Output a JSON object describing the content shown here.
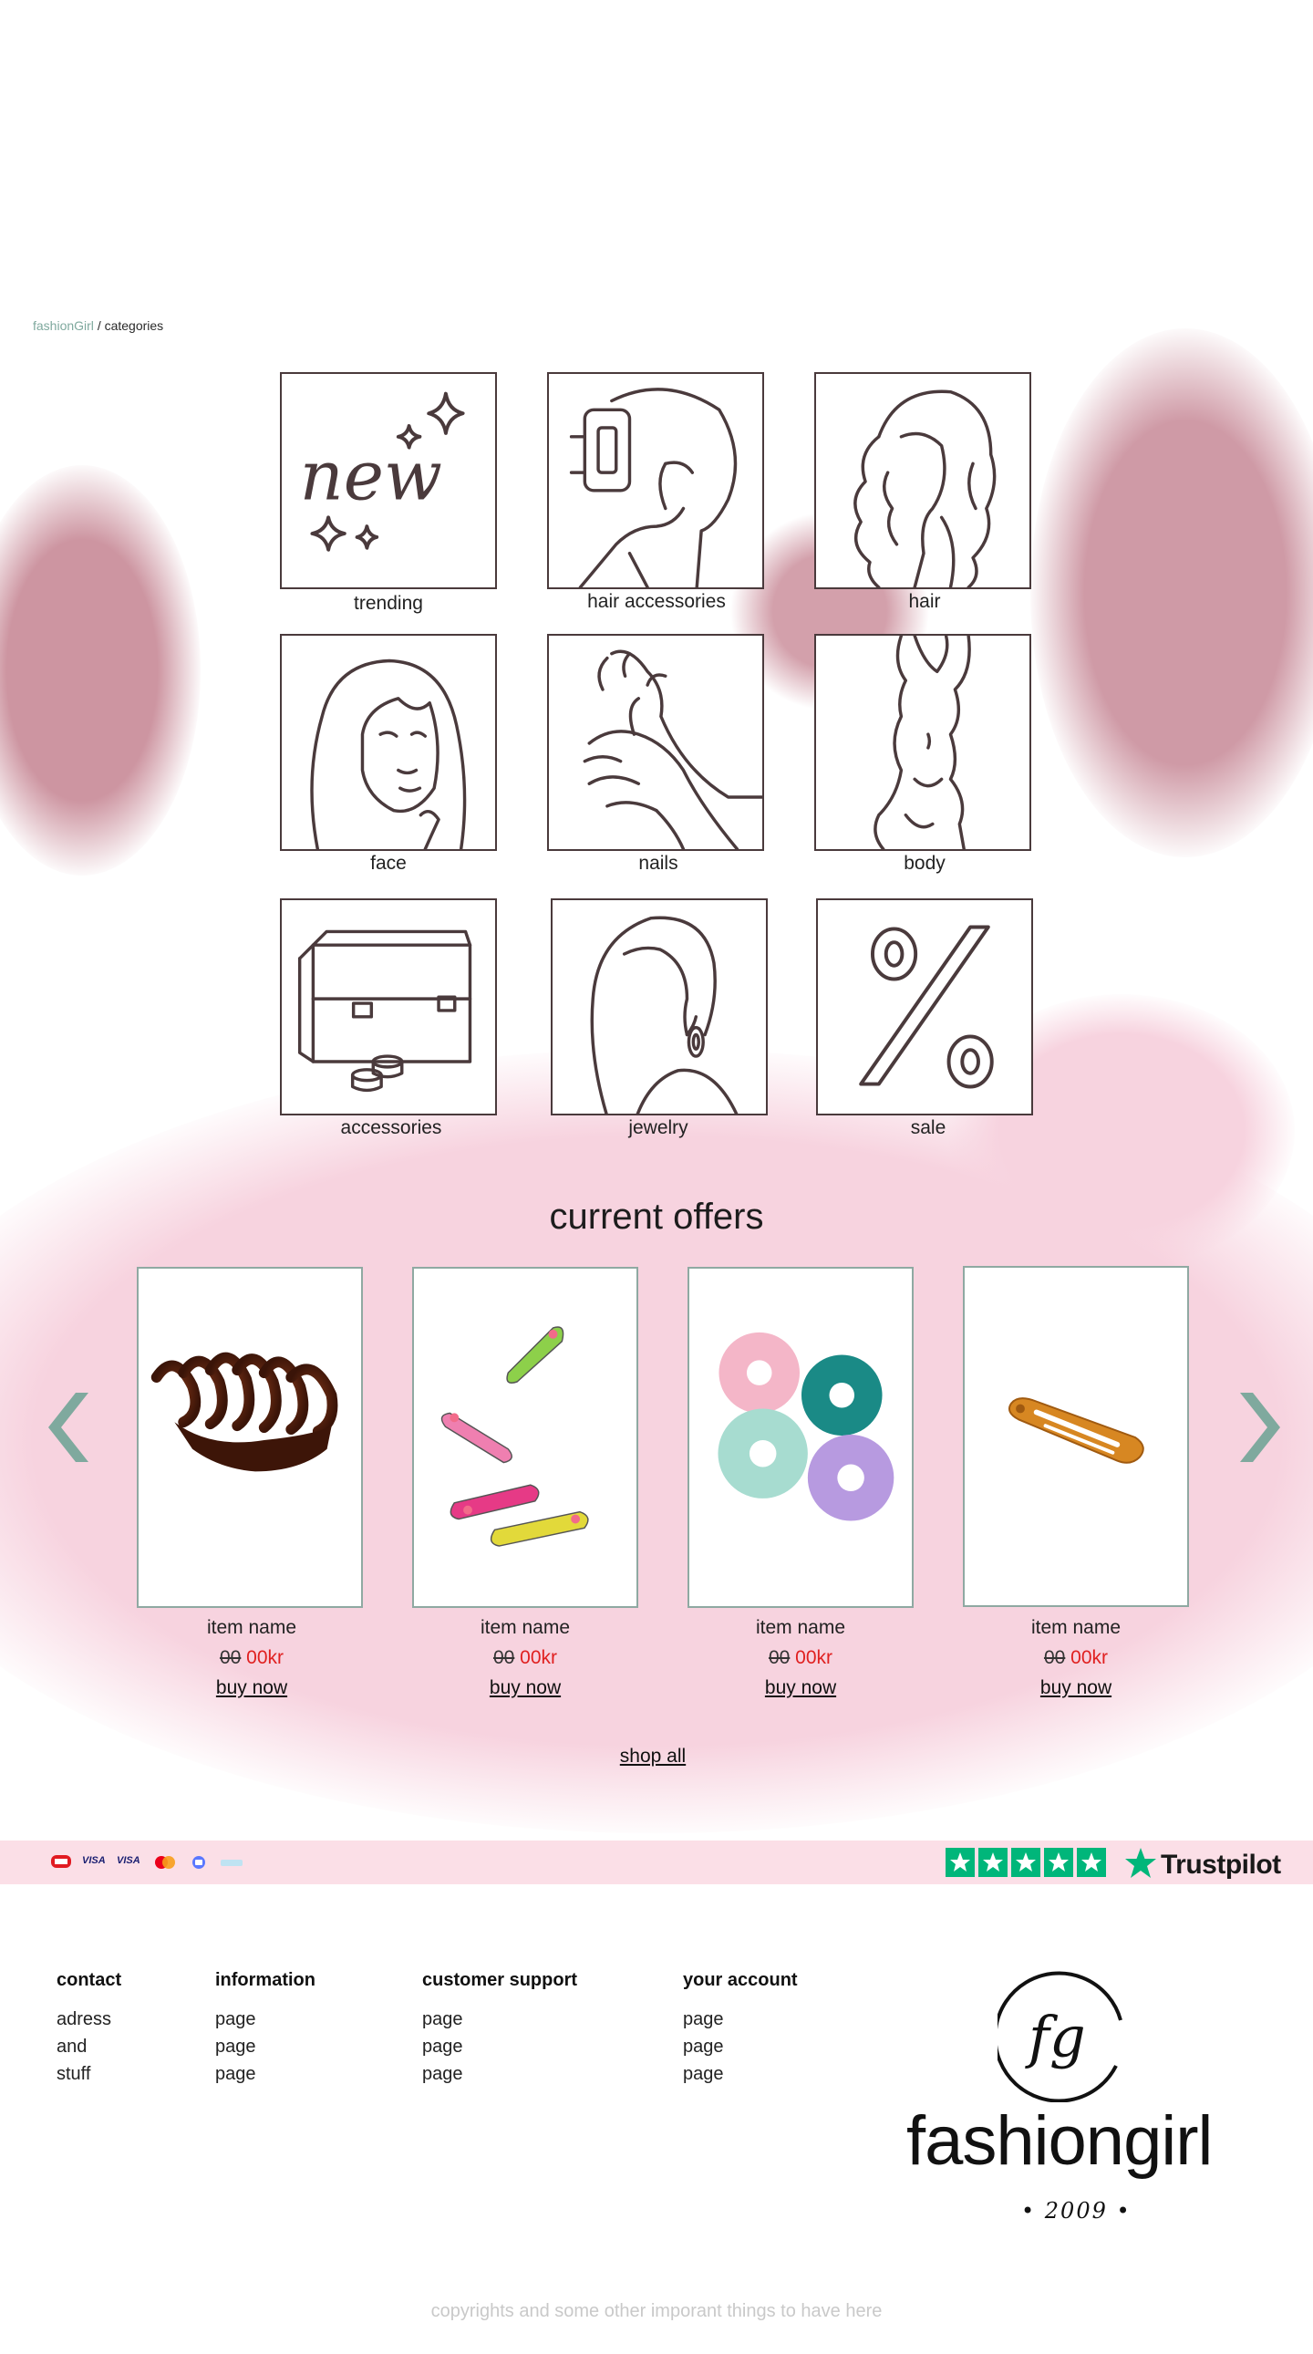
{
  "breadcrumb": {
    "home": "fashionGirl",
    "separator": "/",
    "current": "categories"
  },
  "categories": [
    {
      "label": "trending",
      "icon": "sparkles-new-icon"
    },
    {
      "label": "hair accessories",
      "icon": "hair-claw-icon"
    },
    {
      "label": "hair",
      "icon": "wavy-hair-icon"
    },
    {
      "label": "face",
      "icon": "face-icon"
    },
    {
      "label": "nails",
      "icon": "nails-hand-icon"
    },
    {
      "label": "body",
      "icon": "body-icon"
    },
    {
      "label": "accessories",
      "icon": "vanity-case-icon"
    },
    {
      "label": "jewelry",
      "icon": "earring-icon"
    },
    {
      "label": "sale",
      "icon": "percent-icon"
    }
  ],
  "tile_new_text": "new",
  "offers": {
    "title": "current offers",
    "products": [
      {
        "name": "item name",
        "old_price": "00",
        "price": "00kr",
        "buy": "buy now",
        "image": "tortoise-hair-claw"
      },
      {
        "name": "item name",
        "old_price": "00",
        "price": "00kr",
        "buy": "buy now",
        "image": "colorful-snap-clips"
      },
      {
        "name": "item name",
        "old_price": "00",
        "price": "00kr",
        "buy": "buy now",
        "image": "satin-scrunchies"
      },
      {
        "name": "item name",
        "old_price": "00",
        "price": "00kr",
        "buy": "buy now",
        "image": "orange-snap-clip"
      }
    ],
    "shop_all": "shop all"
  },
  "payment": {
    "methods": [
      "dankort-icon",
      "visa-icon",
      "visa-electron-icon",
      "mastercard-icon",
      "mobilepay-icon",
      "applepay-icon"
    ],
    "labels": [
      "",
      "VISA",
      "VISA",
      "",
      "",
      ""
    ],
    "trustpilot": {
      "stars": 5,
      "word": "Trustpilot"
    }
  },
  "footer": {
    "columns": [
      {
        "heading": "contact",
        "items": [
          "adress",
          "and",
          "stuff"
        ]
      },
      {
        "heading": "information",
        "items": [
          "page",
          "page",
          "page"
        ]
      },
      {
        "heading": "customer support",
        "items": [
          "page",
          "page",
          "page"
        ]
      },
      {
        "heading": "your account",
        "items": [
          "page",
          "page",
          "page"
        ]
      }
    ],
    "logo": {
      "monogram": "fg",
      "wordmark": "fashiongirl",
      "year": "• 2009 •"
    },
    "copyright": "copyrights and some other imporant things to have here"
  },
  "colors": {
    "accent": "#7fa99e",
    "sale_price": "#e02020",
    "pink_blot": "#c98f9c",
    "light_pink": "#f7d3df",
    "trustpilot": "#00b67a"
  }
}
